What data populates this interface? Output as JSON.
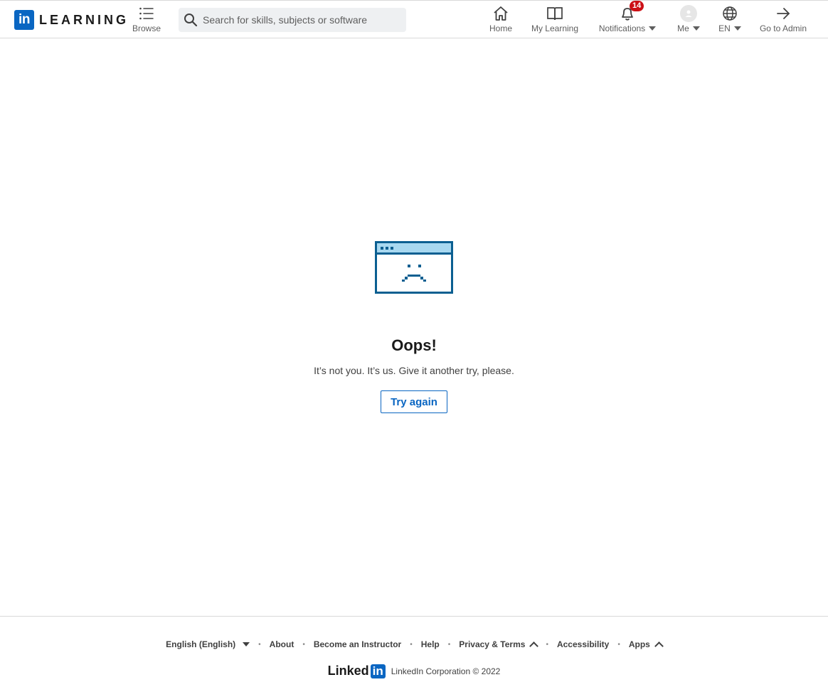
{
  "header": {
    "logo_box": "in",
    "logo_text": "LEARNING",
    "browse": {
      "label": "Browse",
      "icon": "list-icon"
    },
    "search": {
      "placeholder": "Search for skills, subjects or software",
      "value": ""
    },
    "nav": {
      "home": "Home",
      "my_learning": "My Learning",
      "notifications": "Notifications",
      "notifications_count": "14",
      "me": "Me",
      "language": "EN",
      "admin": "Go to Admin"
    }
  },
  "error": {
    "title": "Oops!",
    "message": "It’s not you. It’s us. Give it another try, please.",
    "button": "Try again"
  },
  "footer": {
    "language": "English (English)",
    "about": "About",
    "instructor": "Become an Instructor",
    "help": "Help",
    "privacy": "Privacy & Terms",
    "accessibility": "Accessibility",
    "apps": "Apps",
    "brand_word": "Linked",
    "brand_in": "in",
    "copyright": "LinkedIn Corporation © 2022"
  },
  "colors": {
    "brand": "#0a66c2",
    "badge": "#cc1016",
    "illustration_fill": "#a8d8f0",
    "illustration_stroke": "#0b5f91"
  }
}
